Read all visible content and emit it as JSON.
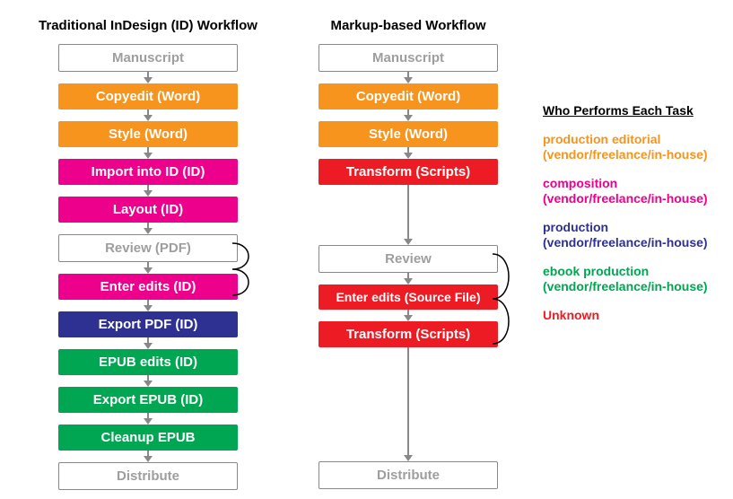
{
  "chart_data": {
    "type": "diagram-flow",
    "legend_title": "Who Performs Each Task",
    "roles": {
      "orange": {
        "label": "production editorial",
        "sub": "(vendor/freelance/in-house)"
      },
      "magenta": {
        "label": "composition",
        "sub": "(vendor/freelance/in-house)"
      },
      "blue": {
        "label": "production",
        "sub": "(vendor/freelance/in-house)"
      },
      "green": {
        "label": "ebook production",
        "sub": "(vendor/freelance/in-house)"
      },
      "red": {
        "label": "Unknown",
        "sub": ""
      }
    },
    "columns": [
      {
        "title": "Traditional InDesign (ID) Workflow",
        "loop_between_indices": [
          5,
          6
        ],
        "steps": [
          {
            "label": "Manuscript",
            "style": "outline"
          },
          {
            "label": "Copyedit (Word)",
            "style": "orange"
          },
          {
            "label": "Style (Word)",
            "style": "orange"
          },
          {
            "label": "Import into ID (ID)",
            "style": "magenta"
          },
          {
            "label": "Layout (ID)",
            "style": "magenta"
          },
          {
            "label": "Review (PDF)",
            "style": "outline"
          },
          {
            "label": "Enter edits (ID)",
            "style": "magenta"
          },
          {
            "label": "Export PDF (ID)",
            "style": "blue"
          },
          {
            "label": "EPUB edits (ID)",
            "style": "green"
          },
          {
            "label": "Export EPUB (ID)",
            "style": "green"
          },
          {
            "label": "Cleanup EPUB",
            "style": "green"
          },
          {
            "label": "Distribute",
            "style": "outline"
          }
        ]
      },
      {
        "title": "Markup-based Workflow",
        "loop_between_indices": [
          5,
          7
        ],
        "steps": [
          {
            "label": "Manuscript",
            "style": "outline"
          },
          {
            "label": "Copyedit (Word)",
            "style": "orange"
          },
          {
            "label": "Style (Word)",
            "style": "orange"
          },
          {
            "label": "Transform (Scripts)",
            "style": "red"
          },
          {
            "label": "_gap_med",
            "style": "gap"
          },
          {
            "label": "Review",
            "style": "outline"
          },
          {
            "label": "Enter edits (Source File)",
            "style": "red"
          },
          {
            "label": "Transform (Scripts)",
            "style": "red"
          },
          {
            "label": "_gap_xlong",
            "style": "gap"
          },
          {
            "label": "Distribute",
            "style": "outline"
          }
        ]
      }
    ]
  }
}
